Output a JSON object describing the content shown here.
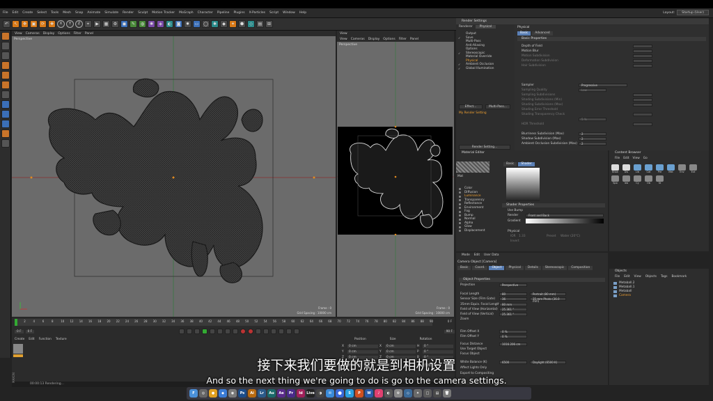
{
  "menubar": {
    "items": [
      "File",
      "Edit",
      "Create",
      "Select",
      "Tools",
      "Mesh",
      "Snap",
      "Animate",
      "Simulate",
      "Render",
      "Sculpt",
      "Motion Tracker",
      "MoGraph",
      "Character",
      "Pipeline",
      "Plugins",
      "X-Particles",
      "Script",
      "Window",
      "Help"
    ],
    "layout_label": "Layout:",
    "layout_value": "Startup (User)"
  },
  "viewport_main": {
    "menu": [
      "View",
      "Cameras",
      "Display",
      "Options",
      "Filter",
      "Panel"
    ],
    "label": "Perspective",
    "frame": "Frame : 0",
    "grid_spacing": "Grid Spacing : 10000 cm"
  },
  "viewport_small": {
    "panel_title": "View",
    "menu": [
      "View",
      "Cameras",
      "Display",
      "Options",
      "Filter",
      "Panel"
    ],
    "label": "Perspective",
    "frame": "Frame : 0",
    "grid_spacing": "Grid Spacing : 10000 cm"
  },
  "timeline": {
    "ticks": [
      "0",
      "2",
      "4",
      "6",
      "8",
      "10",
      "12",
      "14",
      "16",
      "18",
      "20",
      "22",
      "24",
      "26",
      "28",
      "30",
      "32",
      "34",
      "36",
      "38",
      "40",
      "42",
      "44",
      "46",
      "48",
      "50",
      "52",
      "54",
      "56",
      "58",
      "60",
      "62",
      "64",
      "66",
      "68",
      "70",
      "72",
      "74",
      "76",
      "78",
      "80",
      "82",
      "84",
      "86",
      "88",
      "90"
    ],
    "start": "0 F",
    "end": "90 F",
    "current": "0 F"
  },
  "material_panel": {
    "menu": [
      "Create",
      "Edit",
      "Function",
      "Texture"
    ]
  },
  "coord_panel": {
    "headers": [
      "Position",
      "Size",
      "Rotation"
    ],
    "rows": [
      [
        "X",
        "0 cm",
        "X",
        "0 cm",
        "H",
        "0 °"
      ],
      [
        "Y",
        "0 cm",
        "Y",
        "0 cm",
        "P",
        "0 °"
      ],
      [
        "Z",
        "0 cm",
        "Z",
        "0 cm",
        "B",
        "0 °"
      ]
    ],
    "mode": "Object (Rel)",
    "size_mode": "Size",
    "apply": "Apply"
  },
  "status": "00:00:13 Rendering...",
  "render_settings": {
    "title": "Render Settings",
    "renderer_label": "Renderer",
    "renderer_value": "Physical",
    "items": [
      {
        "label": "Output",
        "on": false,
        "hl": false
      },
      {
        "label": "Save",
        "on": true,
        "hl": false
      },
      {
        "label": "Multi-Pass",
        "on": false,
        "hl": false
      },
      {
        "label": "Anti-Aliasing",
        "on": false,
        "hl": false
      },
      {
        "label": "Options",
        "on": false,
        "hl": false
      },
      {
        "label": "Stereoscopic",
        "on": true,
        "hl": false
      },
      {
        "label": "Material Override",
        "on": false,
        "hl": false
      },
      {
        "label": "Physical",
        "on": false,
        "hl": true
      },
      {
        "label": "Ambient Occlusion",
        "on": true,
        "hl": false
      },
      {
        "label": "Global Illumination",
        "on": true,
        "hl": false
      }
    ],
    "effect_btn": "Effect...",
    "multipass_btn": "Multi-Pass...",
    "my_setting": "My Render Setting",
    "render_setting_btn": "Render Setting...",
    "right_title": "Physical",
    "tabs": [
      "Basic",
      "Advanced"
    ],
    "basic_props": "Basic Properties",
    "rows": [
      {
        "label": "Depth of Field",
        "dim": false
      },
      {
        "label": "Motion Blur",
        "dim": false
      },
      {
        "label": "Motion Subdivision",
        "dim": true
      },
      {
        "label": "Deformation Subdivision",
        "dim": true
      },
      {
        "label": "Hair Subdivision",
        "dim": true
      },
      {
        "label": "Sampler",
        "dim": false
      },
      {
        "label": "Sampling Quality",
        "dim": true
      },
      {
        "label": "Sampling Subdivisions",
        "dim": true
      },
      {
        "label": "Shading Subdivisions (Min)",
        "dim": true
      },
      {
        "label": "Shading Subdivisions (Max)",
        "dim": true
      },
      {
        "label": "Shading Error Threshold",
        "dim": true
      },
      {
        "label": "Shading Transparency Check",
        "dim": true
      },
      {
        "label": "HDR Threshold",
        "dim": true
      },
      {
        "label": "Blurriness Subdivision (Max)",
        "dim": false
      },
      {
        "label": "Shadow Subdivision (Max)",
        "dim": false
      },
      {
        "label": "Ambient Occlusion Subdivision (Max)",
        "dim": false
      }
    ],
    "sampler_value": "Progressive",
    "quality_value": "Low",
    "error_value": "5 %",
    "blur_value": "2",
    "shadow_value": "2",
    "ao_value": "2"
  },
  "material_editor": {
    "title": "Material Editor",
    "mat_name": "Mat",
    "channels": [
      {
        "label": "Color",
        "hl": false
      },
      {
        "label": "Diffusion",
        "hl": false
      },
      {
        "label": "Luminance",
        "hl": true
      },
      {
        "label": "Transparency",
        "hl": false
      },
      {
        "label": "Reflectance",
        "hl": false
      },
      {
        "label": "Environment",
        "hl": false
      },
      {
        "label": "Fog",
        "hl": false
      },
      {
        "label": "Bump",
        "hl": false
      },
      {
        "label": "Normal",
        "hl": false
      },
      {
        "label": "Alpha",
        "hl": false
      },
      {
        "label": "Glow",
        "hl": false
      },
      {
        "label": "Displacement",
        "hl": false
      }
    ],
    "tabs": [
      "Basic",
      "Shader"
    ],
    "shader_props": "Shader Properties",
    "use_bump": "Use Bump",
    "render_label": "Render",
    "render_value": "Front and Back",
    "gradient_label": "Gradient",
    "physical_label": "Physical",
    "ior_label": "IOR",
    "ior_value": "1.33",
    "preset_label": "Preset",
    "preset_value": "Water (20°C)",
    "invert_label": "Invert"
  },
  "content_browser": {
    "title": "Content Browser",
    "menu": [
      "File",
      "Edit",
      "View",
      "Go"
    ],
    "items": [
      "Brow",
      "Dis",
      "Lib",
      "Cat",
      "Pre",
      "Mat",
      "Env",
      "Ext",
      "Spo",
      "lea",
      "Cy",
      "Ob",
      "St"
    ]
  },
  "attributes": {
    "menu": [
      "Mode",
      "Edit",
      "User Data"
    ],
    "object_title": "Camera Object [Camera]",
    "tabs": [
      "Basic",
      "Coord.",
      "Object",
      "Physical",
      "Details",
      "Stereoscopic",
      "Composition"
    ],
    "section": "Object Properties",
    "rows": [
      {
        "label": "Projection",
        "value": "Perspective"
      },
      {
        "label": "Focal Length",
        "value": "80"
      },
      {
        "label": "Sensor Size (Film Gate)",
        "value": "36"
      },
      {
        "label": "35mm Equiv. Focal Length:",
        "value": "80 mm"
      },
      {
        "label": "Field of View (Horizontal)",
        "value": "25.361 °"
      },
      {
        "label": "Field of View (Vertical)",
        "value": "25.361 °"
      },
      {
        "label": "Zoom",
        "value": ""
      },
      {
        "label": "Film Offset X",
        "value": "0 %"
      },
      {
        "label": "Film Offset Y",
        "value": "0 %"
      },
      {
        "label": "Focus Distance",
        "value": "1016.206 cm"
      },
      {
        "label": "Use Target Object",
        "value": ""
      },
      {
        "label": "Focus Object",
        "value": ""
      },
      {
        "label": "White Balance (K)",
        "value": "6500"
      },
      {
        "label": "Affect Lights Only",
        "value": ""
      },
      {
        "label": "Export to Compositing",
        "value": ""
      }
    ],
    "focal_preset": "Portrait (80 mm)",
    "sensor_preset": "35 mm Photo (36.0 mm)",
    "wb_preset": "Daylight (6500 K)"
  },
  "objects": {
    "title": "Objects",
    "menu": [
      "File",
      "Edit",
      "View",
      "Objects",
      "Tags",
      "Bookmark"
    ],
    "items": [
      {
        "label": "Metaball.2",
        "hl": false
      },
      {
        "label": "Metaball.1",
        "hl": false
      },
      {
        "label": "Metaball",
        "hl": false
      },
      {
        "label": "Camera",
        "hl": true
      }
    ]
  },
  "subtitles": {
    "cn": "接下来我们要做的就是到相机设置",
    "en": "And so the next thing we're going to do is go to the camera settings."
  },
  "dock": [
    {
      "label": "F",
      "color": "#4a90d9"
    },
    {
      "label": "◎",
      "color": "#666"
    },
    {
      "label": "●",
      "color": "#e0a020"
    },
    {
      "label": "◆",
      "color": "#3a7bd5"
    },
    {
      "label": "◉",
      "color": "#7a7a7a"
    },
    {
      "label": "Ps",
      "color": "#1b4d8a"
    },
    {
      "label": "Ai",
      "color": "#b86a10"
    },
    {
      "label": "Lr",
      "color": "#2a5a8a"
    },
    {
      "label": "Au",
      "color": "#1a6a6a"
    },
    {
      "label": "Ae",
      "color": "#5a2a8a"
    },
    {
      "label": "Pr",
      "color": "#4a2a8a"
    },
    {
      "label": "Id",
      "color": "#a0205a"
    },
    {
      "label": "Live",
      "color": "#222"
    },
    {
      "label": "◑",
      "color": "#444"
    },
    {
      "label": "✉",
      "color": "#3a8ad9"
    },
    {
      "label": "⬤",
      "color": "#3a6ad9"
    },
    {
      "label": "S",
      "color": "#2aa0e0"
    },
    {
      "label": "P",
      "color": "#d05020"
    },
    {
      "label": "W",
      "color": "#2a5aa8"
    },
    {
      "label": "♪",
      "color": "#e04070"
    },
    {
      "label": "◐",
      "color": "#555"
    },
    {
      "label": "⚙",
      "color": "#888"
    },
    {
      "label": "◇",
      "color": "#3a6a9a"
    },
    {
      "label": "✦",
      "color": "#6a6a6a"
    },
    {
      "label": "□",
      "color": "#5a5a5a"
    },
    {
      "label": "▤",
      "color": "#4a4a4a"
    },
    {
      "label": "🗑",
      "color": "#777"
    }
  ]
}
